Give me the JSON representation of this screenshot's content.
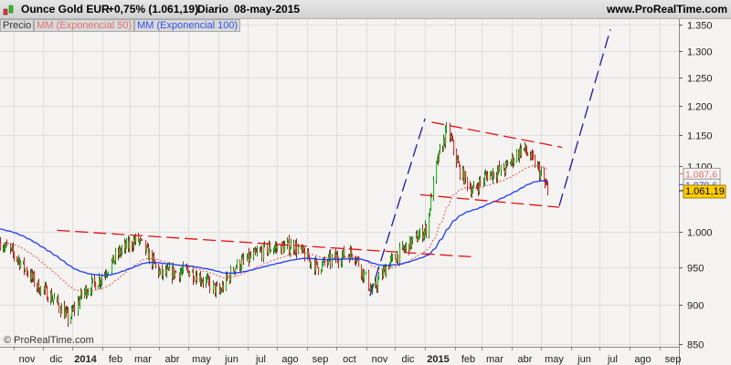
{
  "header": {
    "title": "Ounce Gold EUR",
    "change": "+0,75% (1.061,19)",
    "period": "Diario",
    "date": "08-may-2015",
    "site": "www.ProRealTime.com"
  },
  "legend": {
    "price": "Precio",
    "ema50": "MM (Exponencial 50)",
    "ema100": "MM (Exponencial 100)"
  },
  "watermark": "© ProRealTime.com",
  "colors": {
    "up": "#2ebd2e",
    "down": "#e03a3a",
    "ema50": "#e05050",
    "ema100": "#1e3cf0",
    "trend_red": "#e01010",
    "trend_blue": "#1a1a9a",
    "last_tag": "#ffcc00"
  },
  "chart_data": {
    "type": "candlestick",
    "title": "Ounce Gold EUR",
    "y_scale": "log",
    "ylim": [
      845,
      1370
    ],
    "y_ticks": [
      "1.350",
      "1.300",
      "1.250",
      "1.200",
      "1.150",
      "1.100",
      "1.000",
      "950",
      "900",
      "850"
    ],
    "y_tick_values": [
      1350,
      1300,
      1250,
      1200,
      1150,
      1100,
      1000,
      950,
      900,
      850
    ],
    "x_start": "2013-10-18",
    "x_end": "2015-09-20",
    "x_ticks": [
      {
        "d": "2013-11-01",
        "l": "nov"
      },
      {
        "d": "2013-12-01",
        "l": "dic"
      },
      {
        "d": "2014-01-01",
        "l": "2014",
        "bold": true
      },
      {
        "d": "2014-02-01",
        "l": "feb"
      },
      {
        "d": "2014-03-01",
        "l": "mar"
      },
      {
        "d": "2014-04-01",
        "l": "abr"
      },
      {
        "d": "2014-05-01",
        "l": "may"
      },
      {
        "d": "2014-06-01",
        "l": "jun"
      },
      {
        "d": "2014-07-01",
        "l": "jul"
      },
      {
        "d": "2014-08-01",
        "l": "ago"
      },
      {
        "d": "2014-09-01",
        "l": "sep"
      },
      {
        "d": "2014-10-01",
        "l": "oct"
      },
      {
        "d": "2014-11-01",
        "l": "nov"
      },
      {
        "d": "2014-12-01",
        "l": "dic"
      },
      {
        "d": "2015-01-01",
        "l": "2015",
        "bold": true
      },
      {
        "d": "2015-02-01",
        "l": "feb"
      },
      {
        "d": "2015-03-01",
        "l": "mar"
      },
      {
        "d": "2015-04-01",
        "l": "abr"
      },
      {
        "d": "2015-05-01",
        "l": "may"
      },
      {
        "d": "2015-06-01",
        "l": "jun"
      },
      {
        "d": "2015-07-01",
        "l": "jul"
      },
      {
        "d": "2015-08-01",
        "l": "ago"
      },
      {
        "d": "2015-09-01",
        "l": "sep"
      }
    ],
    "price_path": [
      [
        "2013-10-18",
        985
      ],
      [
        "2013-11-06",
        960
      ],
      [
        "2013-11-25",
        925
      ],
      [
        "2013-12-14",
        905
      ],
      [
        "2013-12-28",
        880
      ],
      [
        "2014-01-11",
        915
      ],
      [
        "2014-01-30",
        935
      ],
      [
        "2014-02-18",
        970
      ],
      [
        "2014-03-09",
        990
      ],
      [
        "2014-04-02",
        940
      ],
      [
        "2014-05-02",
        945
      ],
      [
        "2014-05-19",
        930
      ],
      [
        "2014-06-02",
        915
      ],
      [
        "2014-06-17",
        950
      ],
      [
        "2014-07-20",
        975
      ],
      [
        "2014-08-18",
        980
      ],
      [
        "2014-09-11",
        950
      ],
      [
        "2014-10-04",
        965
      ],
      [
        "2014-10-19",
        970
      ],
      [
        "2014-11-07",
        915
      ],
      [
        "2014-11-21",
        950
      ],
      [
        "2014-12-10",
        975
      ],
      [
        "2015-01-03",
        1005
      ],
      [
        "2015-01-12",
        1100
      ],
      [
        "2015-01-24",
        1160
      ],
      [
        "2015-02-05",
        1095
      ],
      [
        "2015-02-19",
        1060
      ],
      [
        "2015-03-05",
        1085
      ],
      [
        "2015-03-24",
        1095
      ],
      [
        "2015-04-12",
        1130
      ],
      [
        "2015-04-26",
        1100
      ],
      [
        "2015-05-08",
        1061.19
      ]
    ],
    "last_close": 1061.19,
    "tags": [
      {
        "label": "1.087,6",
        "value": 1087.6,
        "series": "ema50"
      },
      {
        "label": "1.070,6",
        "value": 1070.6,
        "series": "ema100"
      },
      {
        "label": "1.061,19",
        "value": 1061.19,
        "series": "price"
      }
    ],
    "trend_lines": [
      {
        "color": "red",
        "from": [
          "2013-12-16",
          1002
        ],
        "to": [
          "2015-02-21",
          964
        ]
      },
      {
        "color": "blue",
        "from": [
          "2014-11-05",
          911
        ],
        "to": [
          "2015-01-01",
          1178
        ]
      },
      {
        "color": "red",
        "from": [
          "2014-12-27",
          1055
        ],
        "to": [
          "2015-05-20",
          1036
        ]
      },
      {
        "color": "red",
        "from": [
          "2015-01-08",
          1172
        ],
        "to": [
          "2015-05-23",
          1130
        ]
      },
      {
        "color": "blue",
        "from": [
          "2015-05-20",
          1038
        ],
        "to": [
          "2015-07-12",
          1341
        ]
      }
    ]
  }
}
